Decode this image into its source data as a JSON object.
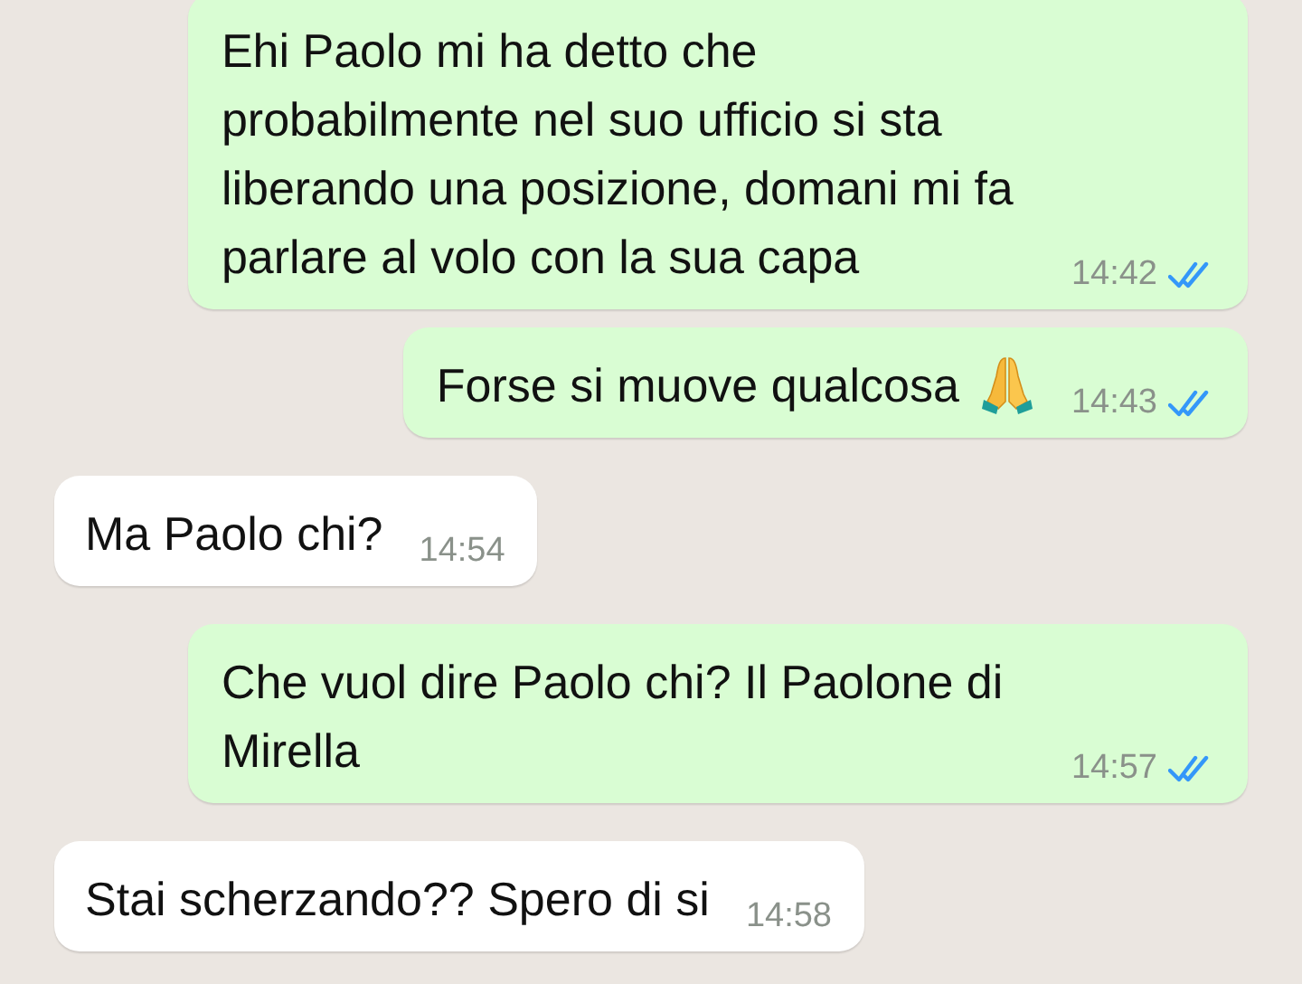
{
  "messages": [
    {
      "kind": "out",
      "text": "Ehi Paolo mi ha detto che probabilmente nel suo ufficio si sta liberando una posizione, domani mi fa parlare al volo con la sua capa",
      "has_emoji": false,
      "time": "14:42",
      "read": true
    },
    {
      "kind": "out",
      "text": "Forse si muove qualcosa",
      "has_emoji": true,
      "time": "14:43",
      "read": true
    },
    {
      "kind": "in",
      "text": "Ma Paolo chi?",
      "has_emoji": false,
      "time": "14:54"
    },
    {
      "kind": "out",
      "text": "Che vuol dire Paolo chi? Il Paolone di Mirella",
      "has_emoji": false,
      "time": "14:57",
      "read": true
    },
    {
      "kind": "in",
      "text": "Stai scherzando?? Spero di si",
      "has_emoji": false,
      "time": "14:58"
    }
  ]
}
